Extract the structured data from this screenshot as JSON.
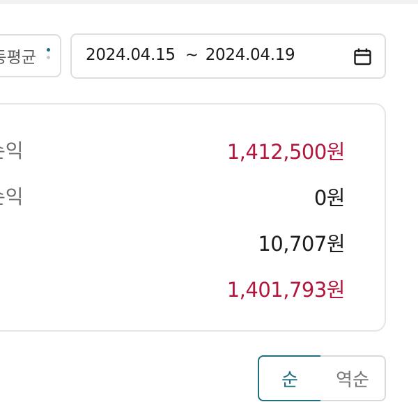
{
  "colors": {
    "profit_red": "#b3163d",
    "neutral_text": "#1a1a1a",
    "accent_teal": "#1e6e80"
  },
  "filters": {
    "method_label": "동평균",
    "date_range": {
      "start": "2024.04.15",
      "separator": "~",
      "end": "2024.04.19"
    },
    "calendar_icon": "calendar-icon",
    "menu_icon": "kebab-icon"
  },
  "summary": {
    "rows": [
      {
        "label": "손익",
        "value": "1,412,500원",
        "tone": "profit"
      },
      {
        "label": "손익",
        "value": "0원",
        "tone": "neutral"
      },
      {
        "label": "",
        "value": "10,707원",
        "tone": "neutral"
      },
      {
        "label": "",
        "value": "1,401,793원",
        "tone": "profit"
      }
    ]
  },
  "sort": {
    "asc_label": "순",
    "desc_label": "역순",
    "selected": "asc"
  }
}
